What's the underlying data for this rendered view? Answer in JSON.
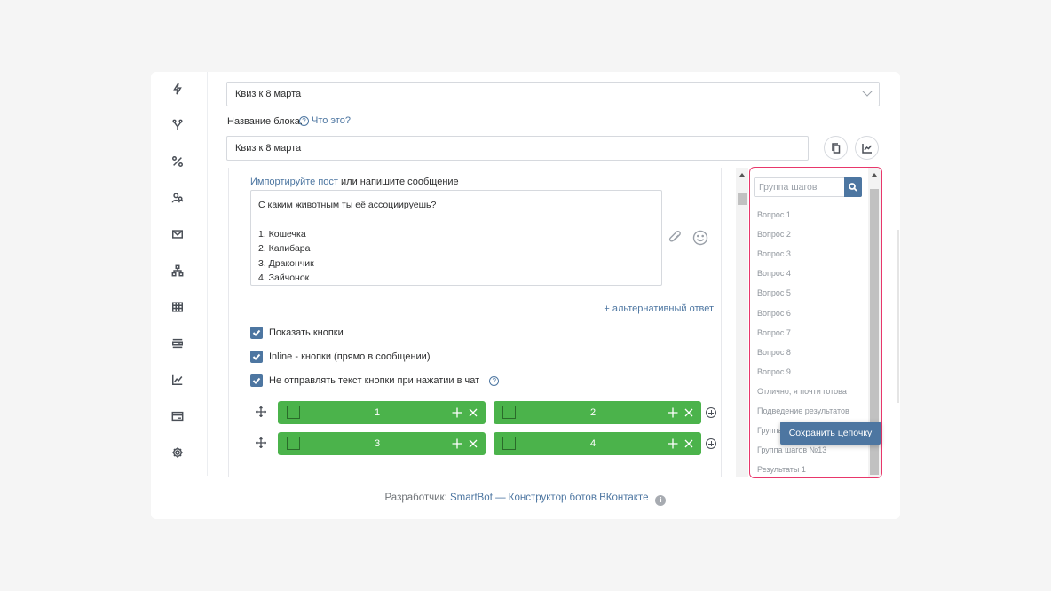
{
  "block_select": {
    "value": "Квиз к 8 марта"
  },
  "block_name": {
    "label": "Название блока.",
    "help": "Что это?",
    "value": "Квиз к 8 марта"
  },
  "editor": {
    "import_link": "Импортируйте пост",
    "import_rest": " или напишите сообщение",
    "message_lines": [
      "С каким животным ты её ассоциируешь?",
      "",
      "1. Кошечка",
      "2. Капибара",
      "3. Дракончик",
      "4. Зайчонок"
    ],
    "alt_answer": "+ альтернативный ответ",
    "checkboxes": [
      {
        "label": "Показать кнопки"
      },
      {
        "label": "Inline - кнопки (прямо в сообщении)"
      },
      {
        "label": "Не отправлять текст кнопки при нажатии в чат"
      }
    ],
    "buttons": [
      "1",
      "2",
      "3",
      "4"
    ]
  },
  "steps": {
    "search_placeholder": "Группа шагов",
    "items": [
      "Вопрос 1",
      "Вопрос 2",
      "Вопрос 3",
      "Вопрос 4",
      "Вопрос 5",
      "Вопрос 6",
      "Вопрос 7",
      "Вопрос 8",
      "Вопрос 9",
      "Отлично, я почти готова",
      "Подведение результатов",
      "Группа",
      "Группа шагов №13",
      "Результаты 1"
    ],
    "save_button": "Сохранить цепочку"
  },
  "footer": {
    "prefix": "Разработчик: ",
    "link": "SmartBot — Конструктор ботов ВКонтакте"
  },
  "colors": {
    "accent": "#4d76a1",
    "green": "#4bb34b",
    "highlight": "#e8376b"
  }
}
